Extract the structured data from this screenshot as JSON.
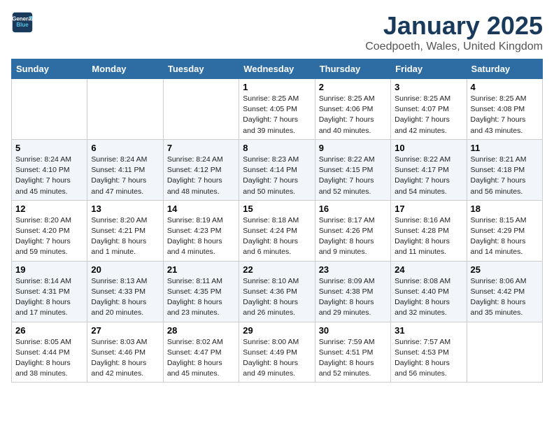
{
  "header": {
    "logo_line1": "General",
    "logo_line2": "Blue",
    "title": "January 2025",
    "subtitle": "Coedpoeth, Wales, United Kingdom"
  },
  "days_of_week": [
    "Sunday",
    "Monday",
    "Tuesday",
    "Wednesday",
    "Thursday",
    "Friday",
    "Saturday"
  ],
  "weeks": [
    [
      {
        "day": "",
        "info": ""
      },
      {
        "day": "",
        "info": ""
      },
      {
        "day": "",
        "info": ""
      },
      {
        "day": "1",
        "info": "Sunrise: 8:25 AM\nSunset: 4:05 PM\nDaylight: 7 hours\nand 39 minutes."
      },
      {
        "day": "2",
        "info": "Sunrise: 8:25 AM\nSunset: 4:06 PM\nDaylight: 7 hours\nand 40 minutes."
      },
      {
        "day": "3",
        "info": "Sunrise: 8:25 AM\nSunset: 4:07 PM\nDaylight: 7 hours\nand 42 minutes."
      },
      {
        "day": "4",
        "info": "Sunrise: 8:25 AM\nSunset: 4:08 PM\nDaylight: 7 hours\nand 43 minutes."
      }
    ],
    [
      {
        "day": "5",
        "info": "Sunrise: 8:24 AM\nSunset: 4:10 PM\nDaylight: 7 hours\nand 45 minutes."
      },
      {
        "day": "6",
        "info": "Sunrise: 8:24 AM\nSunset: 4:11 PM\nDaylight: 7 hours\nand 47 minutes."
      },
      {
        "day": "7",
        "info": "Sunrise: 8:24 AM\nSunset: 4:12 PM\nDaylight: 7 hours\nand 48 minutes."
      },
      {
        "day": "8",
        "info": "Sunrise: 8:23 AM\nSunset: 4:14 PM\nDaylight: 7 hours\nand 50 minutes."
      },
      {
        "day": "9",
        "info": "Sunrise: 8:22 AM\nSunset: 4:15 PM\nDaylight: 7 hours\nand 52 minutes."
      },
      {
        "day": "10",
        "info": "Sunrise: 8:22 AM\nSunset: 4:17 PM\nDaylight: 7 hours\nand 54 minutes."
      },
      {
        "day": "11",
        "info": "Sunrise: 8:21 AM\nSunset: 4:18 PM\nDaylight: 7 hours\nand 56 minutes."
      }
    ],
    [
      {
        "day": "12",
        "info": "Sunrise: 8:20 AM\nSunset: 4:20 PM\nDaylight: 7 hours\nand 59 minutes."
      },
      {
        "day": "13",
        "info": "Sunrise: 8:20 AM\nSunset: 4:21 PM\nDaylight: 8 hours\nand 1 minute."
      },
      {
        "day": "14",
        "info": "Sunrise: 8:19 AM\nSunset: 4:23 PM\nDaylight: 8 hours\nand 4 minutes."
      },
      {
        "day": "15",
        "info": "Sunrise: 8:18 AM\nSunset: 4:24 PM\nDaylight: 8 hours\nand 6 minutes."
      },
      {
        "day": "16",
        "info": "Sunrise: 8:17 AM\nSunset: 4:26 PM\nDaylight: 8 hours\nand 9 minutes."
      },
      {
        "day": "17",
        "info": "Sunrise: 8:16 AM\nSunset: 4:28 PM\nDaylight: 8 hours\nand 11 minutes."
      },
      {
        "day": "18",
        "info": "Sunrise: 8:15 AM\nSunset: 4:29 PM\nDaylight: 8 hours\nand 14 minutes."
      }
    ],
    [
      {
        "day": "19",
        "info": "Sunrise: 8:14 AM\nSunset: 4:31 PM\nDaylight: 8 hours\nand 17 minutes."
      },
      {
        "day": "20",
        "info": "Sunrise: 8:13 AM\nSunset: 4:33 PM\nDaylight: 8 hours\nand 20 minutes."
      },
      {
        "day": "21",
        "info": "Sunrise: 8:11 AM\nSunset: 4:35 PM\nDaylight: 8 hours\nand 23 minutes."
      },
      {
        "day": "22",
        "info": "Sunrise: 8:10 AM\nSunset: 4:36 PM\nDaylight: 8 hours\nand 26 minutes."
      },
      {
        "day": "23",
        "info": "Sunrise: 8:09 AM\nSunset: 4:38 PM\nDaylight: 8 hours\nand 29 minutes."
      },
      {
        "day": "24",
        "info": "Sunrise: 8:08 AM\nSunset: 4:40 PM\nDaylight: 8 hours\nand 32 minutes."
      },
      {
        "day": "25",
        "info": "Sunrise: 8:06 AM\nSunset: 4:42 PM\nDaylight: 8 hours\nand 35 minutes."
      }
    ],
    [
      {
        "day": "26",
        "info": "Sunrise: 8:05 AM\nSunset: 4:44 PM\nDaylight: 8 hours\nand 38 minutes."
      },
      {
        "day": "27",
        "info": "Sunrise: 8:03 AM\nSunset: 4:46 PM\nDaylight: 8 hours\nand 42 minutes."
      },
      {
        "day": "28",
        "info": "Sunrise: 8:02 AM\nSunset: 4:47 PM\nDaylight: 8 hours\nand 45 minutes."
      },
      {
        "day": "29",
        "info": "Sunrise: 8:00 AM\nSunset: 4:49 PM\nDaylight: 8 hours\nand 49 minutes."
      },
      {
        "day": "30",
        "info": "Sunrise: 7:59 AM\nSunset: 4:51 PM\nDaylight: 8 hours\nand 52 minutes."
      },
      {
        "day": "31",
        "info": "Sunrise: 7:57 AM\nSunset: 4:53 PM\nDaylight: 8 hours\nand 56 minutes."
      },
      {
        "day": "",
        "info": ""
      }
    ]
  ]
}
